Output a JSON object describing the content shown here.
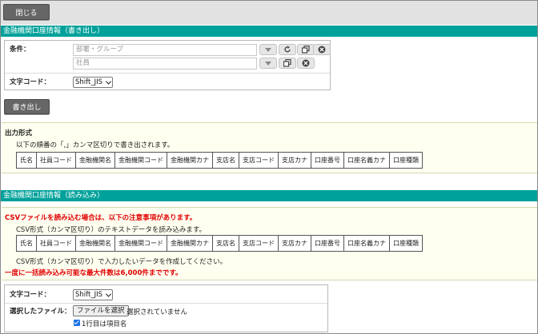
{
  "toolbar": {
    "close_label": "閉じる"
  },
  "export_section": {
    "title": "金融機関口座情報（書き出し）",
    "condition_label": "条件：",
    "dept_placeholder": "部署・グループ",
    "employee_placeholder": "社員",
    "charcode_label": "文字コード：",
    "charcode_value": "Shift_JIS",
    "export_button": "書き出し",
    "output_title": "出力形式",
    "output_desc": "以下の順番の「,」カンマ区切りで書き出されます。",
    "columns": [
      "氏名",
      "社員コード",
      "金融機関名",
      "金融機関コード",
      "金融機関カナ",
      "支店名",
      "支店コード",
      "支店カナ",
      "口座番号",
      "口座名義カナ",
      "口座種類"
    ]
  },
  "import_section": {
    "title": "金融機関口座情報（読み込み）",
    "warning": "CSVファイルを読み込む場合は、以下の注意事項があります。",
    "csv_desc": "CSV形式（カンマ区切り）のテキストデータを読み込みます。",
    "columns": [
      "氏名",
      "社員コード",
      "金融機関名",
      "金融機関コード",
      "金融機関カナ",
      "支店名",
      "支店コード",
      "支店カナ",
      "口座番号",
      "口座名義カナ",
      "口座種類"
    ],
    "create_desc": "CSV形式（カンマ区切り）で入力したいデータを作成してください。",
    "limit_note": "一度に一括読み込み可能な最大件数は6,000件までです。",
    "charcode_label": "文字コード：",
    "charcode_value": "Shift_JIS",
    "file_label": "選択したファイル：",
    "file_button": "ファイルを選択",
    "file_status": "選択されていません",
    "header_checkbox_label": "1行目は項目名"
  }
}
